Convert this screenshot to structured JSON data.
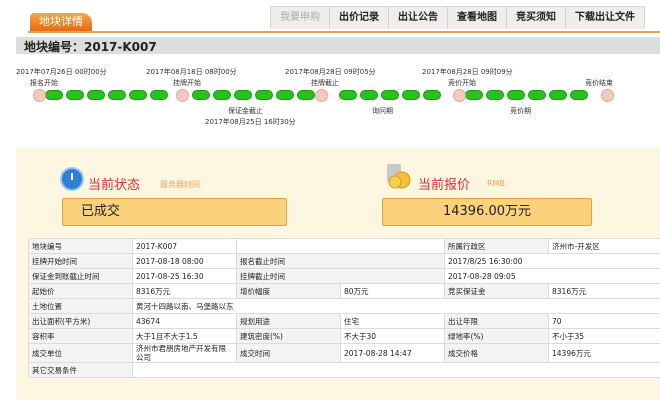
{
  "header": {
    "tab_title": "地块详情",
    "nav": [
      "我要申购",
      "出价记录",
      "出让公告",
      "查看地图",
      "竞买须知",
      "下载出让文件"
    ],
    "code_title": "地块编号：2017-K007"
  },
  "timeline": {
    "upper": [
      "2017年07月26日 00时00分",
      "2017年08月18日 08时00分",
      "2017年08月28日 09时05分",
      "2017年08月28日 09时09分"
    ],
    "top_labels": [
      "报名开始",
      "挂牌开始",
      "挂牌截止",
      "竞价开始",
      "竞价结束"
    ],
    "bottom_labels": [
      "保证金截止",
      "询问期",
      "竞价期"
    ],
    "bottom_date": "2017年08月25日 16时30分"
  },
  "status": {
    "label": "当前状态",
    "sub": "服务器时间",
    "value": "已成交",
    "price_label": "当前报价",
    "price_sub": "RMB",
    "price_value": "14396.00万元"
  },
  "table": {
    "rows": [
      [
        "地块编号",
        "2017-K007",
        "",
        "",
        "所属行政区",
        "济州市-开发区"
      ],
      [
        "挂牌开始时间",
        "2017-08-18 08:00",
        "报名截止时间",
        "",
        "2017/8/25 16:30:00",
        ""
      ],
      [
        "保证金到账截止时间",
        "2017-08-25 16:30",
        "挂牌截止时间",
        "",
        "2017-08-28 09:05",
        ""
      ],
      [
        "起始价",
        "8316万元",
        "增价幅度",
        "80万元",
        "竞买保证金",
        "8316万元"
      ],
      [
        "土地位置",
        "黄河十四路以南、马堡路以东",
        "",
        "",
        "",
        ""
      ],
      [
        "出让面积(平方米)",
        "43674",
        "规划用途",
        "住宅",
        "出让年限",
        "70"
      ],
      [
        "容积率",
        "大于1且不大于1.5",
        "建筑密度(%)",
        "不大于30",
        "绿地率(%)",
        "不小于35"
      ],
      [
        "成交单位",
        "济州市君朋房地产开发有限公司",
        "成交时间",
        "2017-08-28 14:47",
        "成交价格",
        "14396万元"
      ],
      [
        "其它交易条件",
        "",
        "",
        "",
        "",
        ""
      ]
    ]
  }
}
